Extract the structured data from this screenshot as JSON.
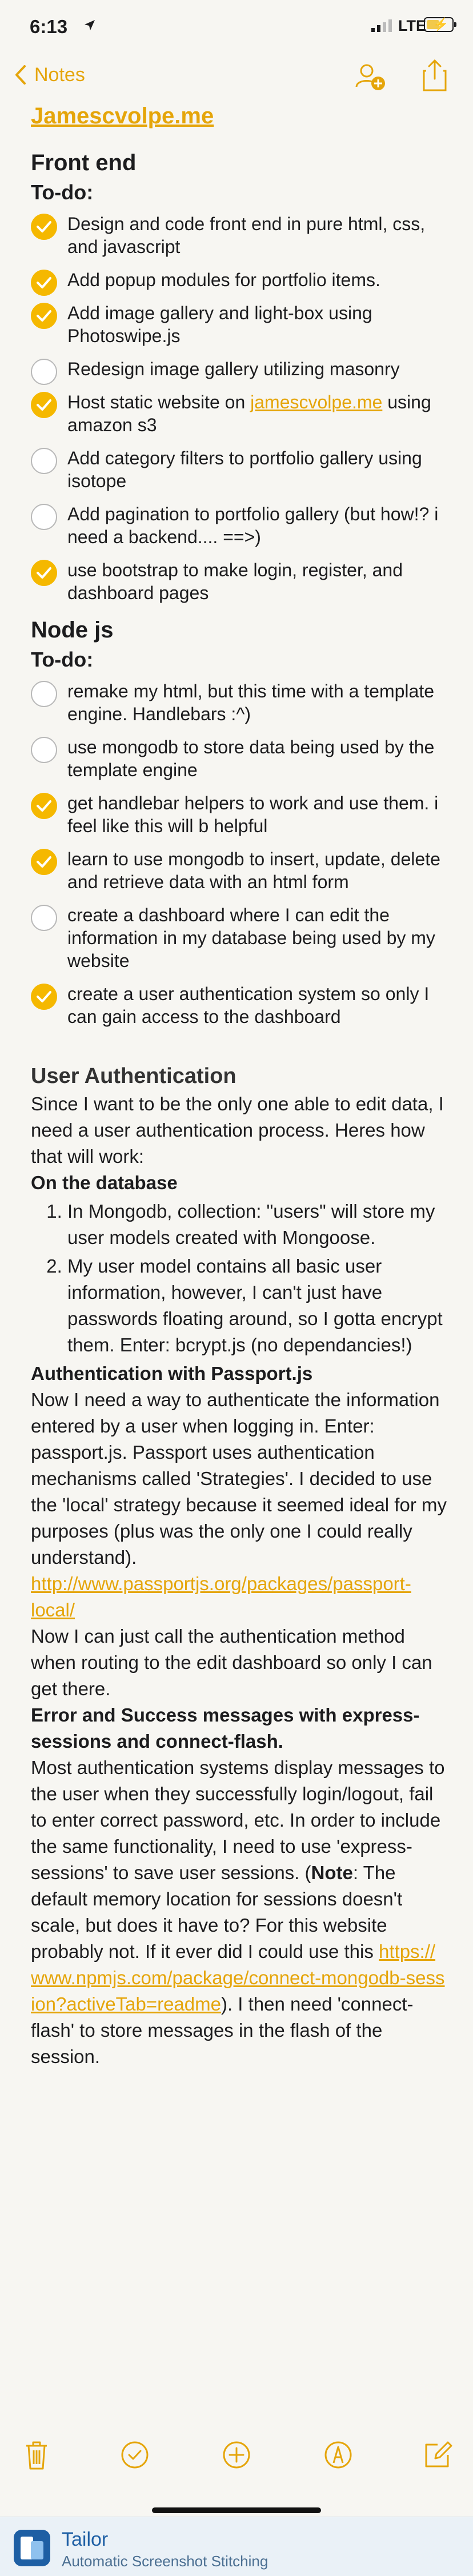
{
  "status": {
    "time": "6:13",
    "network": "LTE"
  },
  "nav": {
    "back_label": "Notes"
  },
  "note": {
    "title_link": "Jamescvolpe.me",
    "frontend": {
      "heading": "Front end",
      "todo": "To-do:",
      "items": [
        {
          "text": " Design and code front end in pure html, css, and javascript",
          "done": true
        },
        {
          "text": "Add popup modules for portfolio items.",
          "done": true
        },
        {
          "text": "Add image gallery and light-box using Photoswipe.js",
          "done": true
        },
        {
          "text": "Redesign image gallery utilizing masonry",
          "done": false
        },
        {
          "text_before": "Host static website on ",
          "link": "jamescvolpe.me",
          "text_after": " using amazon s3",
          "done": true
        },
        {
          "text": "Add category filters to portfolio gallery using isotope",
          "done": false
        },
        {
          "text": "Add pagination to portfolio gallery (but how!? i need a backend.... ==>)",
          "done": false
        },
        {
          "text": "use bootstrap to make login, register, and dashboard pages",
          "done": true
        }
      ]
    },
    "node": {
      "heading": "Node js",
      "todo": "To-do:",
      "items": [
        {
          "text": "remake my html, but this time with a template engine. Handlebars :^)",
          "done": false
        },
        {
          "text": "use mongodb to store data being used by the template engine",
          "done": false
        },
        {
          "text": "get handlebar helpers to work and use them. i feel like this will b helpful",
          "done": true
        },
        {
          "text": "learn to use mongodb to insert, update, delete and retrieve data with an html form",
          "done": true
        },
        {
          "text": "create a dashboard where I can edit the information in my database being used by my website",
          "done": false
        },
        {
          "text": "create a user authentication system so only I can gain access to the dashboard",
          "done": true
        }
      ]
    },
    "auth": {
      "heading": "User Authentication",
      "intro": "Since I want to be the only one able to edit data, I need a user authentication process. Heres how that will work:",
      "db_heading": "On the database",
      "db_steps": [
        "In Mongodb, collection: \"users\" will store my user models created with Mongoose.",
        "My user model contains all basic user information, however, I can't just have passwords floating around, so I gotta encrypt them. Enter: bcrypt.js (no dependancies!)"
      ],
      "passport_heading": "Authentication with Passport.js",
      "passport_text": "Now I need a way to authenticate the information entered by a user when logging in. Enter: passport.js. Passport uses authentication mechanisms called 'Strategies'. I decided to use the 'local' strategy because it seemed ideal for my purposes (plus was the only one I could really understand). ",
      "passport_link": "http://www.passportjs.org/packages/passport-local/",
      "passport_text2": "Now I can just call the authentication method when routing to the edit dashboard so only I can get there.",
      "flash_heading": "Error and Success messages with express-sessions and connect-flash.",
      "flash_text1": "Most authentication systems display messages to the user when they successfully login/logout, fail to enter correct password, etc. In order to include the same functionality, I need to use 'express-sessions' to save user sessions. (",
      "flash_note": "Note",
      "flash_text2": ": The default memory location for sessions doesn't scale, but does it have to? For this website probably not. If it ever did I could use this ",
      "flash_link": "https://www.npmjs.com/package/connect-mongodb-session?activeTab=readme",
      "flash_text3": "). I then need 'connect-flash' to store messages in the flash of the session."
    }
  },
  "tailor": {
    "name": "Tailor",
    "tagline": "Automatic Screenshot Stitching"
  },
  "colors": {
    "accent": "#e5a50a",
    "check": "#f5b800",
    "background": "#f7f6f2"
  },
  "icons": [
    "location-arrow-icon",
    "signal-bars-icon",
    "battery-icon",
    "chevron-left-icon",
    "add-person-icon",
    "share-icon",
    "trash-icon",
    "checklist-icon",
    "add-icon",
    "markup-icon",
    "compose-icon"
  ]
}
